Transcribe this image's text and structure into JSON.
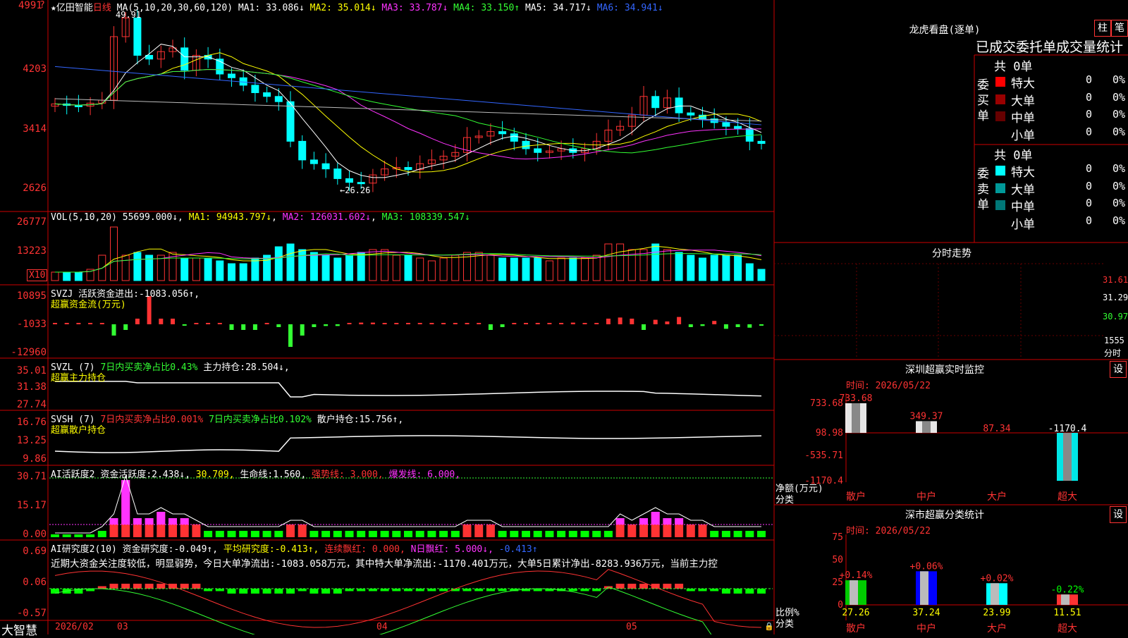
{
  "app": {
    "name": "大智慧",
    "stock": "★亿田智能",
    "period": "日线"
  },
  "price_panel": {
    "ma_label": "MA(5,10,20,30,60,120)",
    "ma": [
      {
        "name": "MA1",
        "value": "33.086↓",
        "color": "#ffffff"
      },
      {
        "name": "MA2",
        "value": "35.014↓",
        "color": "#ffff00"
      },
      {
        "name": "MA3",
        "value": "33.787↓",
        "color": "#ff33ff"
      },
      {
        "name": "MA4",
        "value": "33.150↑",
        "color": "#33ff33"
      },
      {
        "name": "MA5",
        "value": "34.717↓",
        "color": "#ffffff"
      },
      {
        "name": "MA6",
        "value": "34.941↓",
        "color": "#3366ff"
      }
    ],
    "y_ticks": [
      "4991",
      "4203",
      "3414",
      "2626"
    ],
    "high_label": "49.91",
    "low_label": "←26.26"
  },
  "vol_panel": {
    "header": "VOL(5,10,20)",
    "vol": "55699.000↓",
    "ma1": "MA1: 94943.797↓",
    "ma2": "MA2: 126031.602↓",
    "ma3": "MA3: 108339.547↓",
    "y_ticks": [
      "26777",
      "13223"
    ],
    "unit": "X10"
  },
  "svzj_panel": {
    "name": "SVZJ",
    "title": "活跃资金进出:",
    "value": "-1083.056↑,",
    "subtitle": "超赢资金流(万元)",
    "y_ticks": [
      "10895",
      "-1033",
      "-12960"
    ]
  },
  "svzl_panel": {
    "name": "SVZL (7)",
    "t1": "7日内买卖净占比0.43%",
    "t2": "主力持仓:",
    "v2": "28.504↓,",
    "subtitle": "超赢主力持仓",
    "y_ticks": [
      "35.01",
      "31.38",
      "27.74"
    ]
  },
  "svsh_panel": {
    "name": "SVSH (7)",
    "t1": "7日内买卖净占比0.001%",
    "t2": "7日内买卖净占比0.102%",
    "t3": "散户持仓:",
    "v3": "15.756↑,",
    "subtitle": "超赢散户持仓",
    "y_ticks": [
      "16.76",
      "13.25",
      "9.86"
    ]
  },
  "ai2_panel": {
    "name": "AI活跃度2",
    "t1": "资金活跃度:",
    "v1": "2.438↓,",
    "v2": "30.709,",
    "t3": "生命线:",
    "v3": "1.560,",
    "t4": "强势线: 3.000,",
    "t5": "爆发线: 6.000,",
    "y_ticks": [
      "30.71",
      "15.17",
      "0.00"
    ]
  },
  "ai_research": {
    "name": "AI研究度2(10)",
    "t1": "资金研究度:",
    "v1": "-0.049↑,",
    "t2": "平均研究度:",
    "v2": "-0.413↑,",
    "t3": "连续飘红: 0.000,",
    "t4": "N日飘红: 5.000↓,",
    "v5": "-0.413↑",
    "comment": "近期大资金关注度较低，明显弱势，今日大单净流出:-1083.058万元，其中特大单净流出:-1170.401万元，大单5日累计净出-8283.936万元，当前主力控",
    "y_ticks": [
      "0.69",
      "0.06",
      "-0.57"
    ]
  },
  "x_axis": {
    "labels": [
      "2026/02",
      "03",
      "04",
      "05"
    ]
  },
  "dragon": {
    "title": "龙虎看盘(逐单)",
    "btn1": "柱",
    "btn2": "笔",
    "header": "已成交委托单成交量统计",
    "buy": {
      "label": "委买单",
      "total": "共 0单",
      "rows": [
        {
          "name": "特大",
          "count": "0",
          "pct": "0%",
          "color": "#ff0000"
        },
        {
          "name": "大单",
          "count": "0",
          "pct": "0%",
          "color": "#990000"
        },
        {
          "name": "中单",
          "count": "0",
          "pct": "0%",
          "color": "#660000"
        },
        {
          "name": "小单",
          "count": "0",
          "pct": "0%",
          "color": ""
        }
      ]
    },
    "sell": {
      "label": "委卖单",
      "total": "共 0单",
      "rows": [
        {
          "name": "特大",
          "count": "0",
          "pct": "0%",
          "color": "#00ffff"
        },
        {
          "name": "大单",
          "count": "0",
          "pct": "0%",
          "color": "#009999"
        },
        {
          "name": "中单",
          "count": "0",
          "pct": "0%",
          "color": "#007777"
        },
        {
          "name": "小单",
          "count": "0",
          "pct": "0%",
          "color": ""
        }
      ]
    }
  },
  "intraday": {
    "title": "分时走势",
    "y_ticks": [
      "31.61",
      "31.29",
      "30.97"
    ],
    "vol_tick": "1555",
    "vol_unit": "分时"
  },
  "realtime": {
    "title": "深圳超赢实时监控",
    "btn": "设",
    "time_label": "时间: 2026/05/22",
    "y_ticks": [
      "733.68",
      "98.98",
      "-535.71",
      "-1170.4"
    ],
    "y_unit": "净额(万元)",
    "x_unit": "分类",
    "chart_data": {
      "type": "bar",
      "categories": [
        "散户",
        "中户",
        "大户",
        "超大"
      ],
      "values": [
        733.68,
        349.37,
        87.34,
        -1170.4
      ],
      "ylim": [
        -1170.4,
        733.68
      ]
    }
  },
  "classify": {
    "title": "深市超赢分类统计",
    "btn": "设",
    "time_label": "时间: 2026/05/22",
    "y_ticks": [
      "75",
      "50",
      "25",
      "0"
    ],
    "y_unit": "比例%",
    "x_unit": "分类",
    "chart_data": {
      "type": "bar",
      "categories": [
        "散户",
        "中户",
        "大户",
        "超大"
      ],
      "values": [
        27.26,
        37.24,
        23.99,
        11.51
      ],
      "changes": [
        "+0.14%",
        "+0.06%",
        "+0.02%",
        "-0.22%"
      ],
      "ylim": [
        0,
        75
      ]
    }
  }
}
